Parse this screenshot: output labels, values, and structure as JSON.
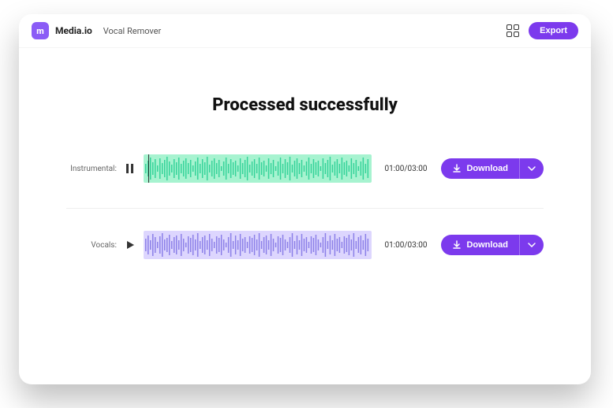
{
  "header": {
    "brand": "Media.io",
    "tool": "Vocal Remover",
    "export_label": "Export"
  },
  "main": {
    "title": "Processed successfully",
    "tracks": [
      {
        "label": "Instrumental:",
        "state": "playing",
        "time_current": "01:00",
        "time_total": "03:00",
        "download_label": "Download",
        "color": "green"
      },
      {
        "label": "Vocals:",
        "state": "paused",
        "time_current": "01:00",
        "time_total": "03:00",
        "download_label": "Download",
        "color": "purple"
      }
    ]
  },
  "colors": {
    "accent": "#7C3AED",
    "waveform_green": "#34D399",
    "waveform_purple": "#8B7FE8"
  }
}
